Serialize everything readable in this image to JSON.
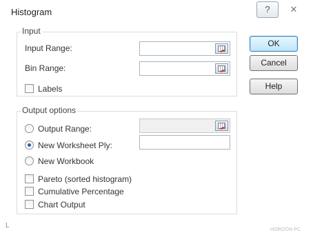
{
  "window": {
    "title": "Histogram",
    "help_symbol": "?",
    "close_symbol": "✕"
  },
  "input_group": {
    "label": "Input",
    "input_range_label": "Input Range:",
    "input_range_value": "",
    "bin_range_label": "Bin Range:",
    "bin_range_value": "",
    "labels_checkbox": "Labels",
    "labels_checked": false
  },
  "output_group": {
    "label": "Output options",
    "options": [
      {
        "label": "Output Range:",
        "selected": false
      },
      {
        "label": "New Worksheet Ply:",
        "selected": true
      },
      {
        "label": "New Workbook",
        "selected": false
      }
    ],
    "output_range_value": "",
    "new_worksheet_value": "",
    "checkboxes": [
      {
        "label": "Pareto (sorted histogram)",
        "checked": false
      },
      {
        "label": "Cumulative Percentage",
        "checked": false
      },
      {
        "label": "Chart Output",
        "checked": false
      }
    ]
  },
  "buttons": {
    "ok": "OK",
    "cancel": "Cancel",
    "help": "Help"
  },
  "footer": {
    "corner_mark": "L",
    "watermark": "HORIZON PC"
  },
  "colors": {
    "default_button": "#bee6fd",
    "radio_dot": "#2a5fb0",
    "ref_arrow": "#c0302a"
  }
}
